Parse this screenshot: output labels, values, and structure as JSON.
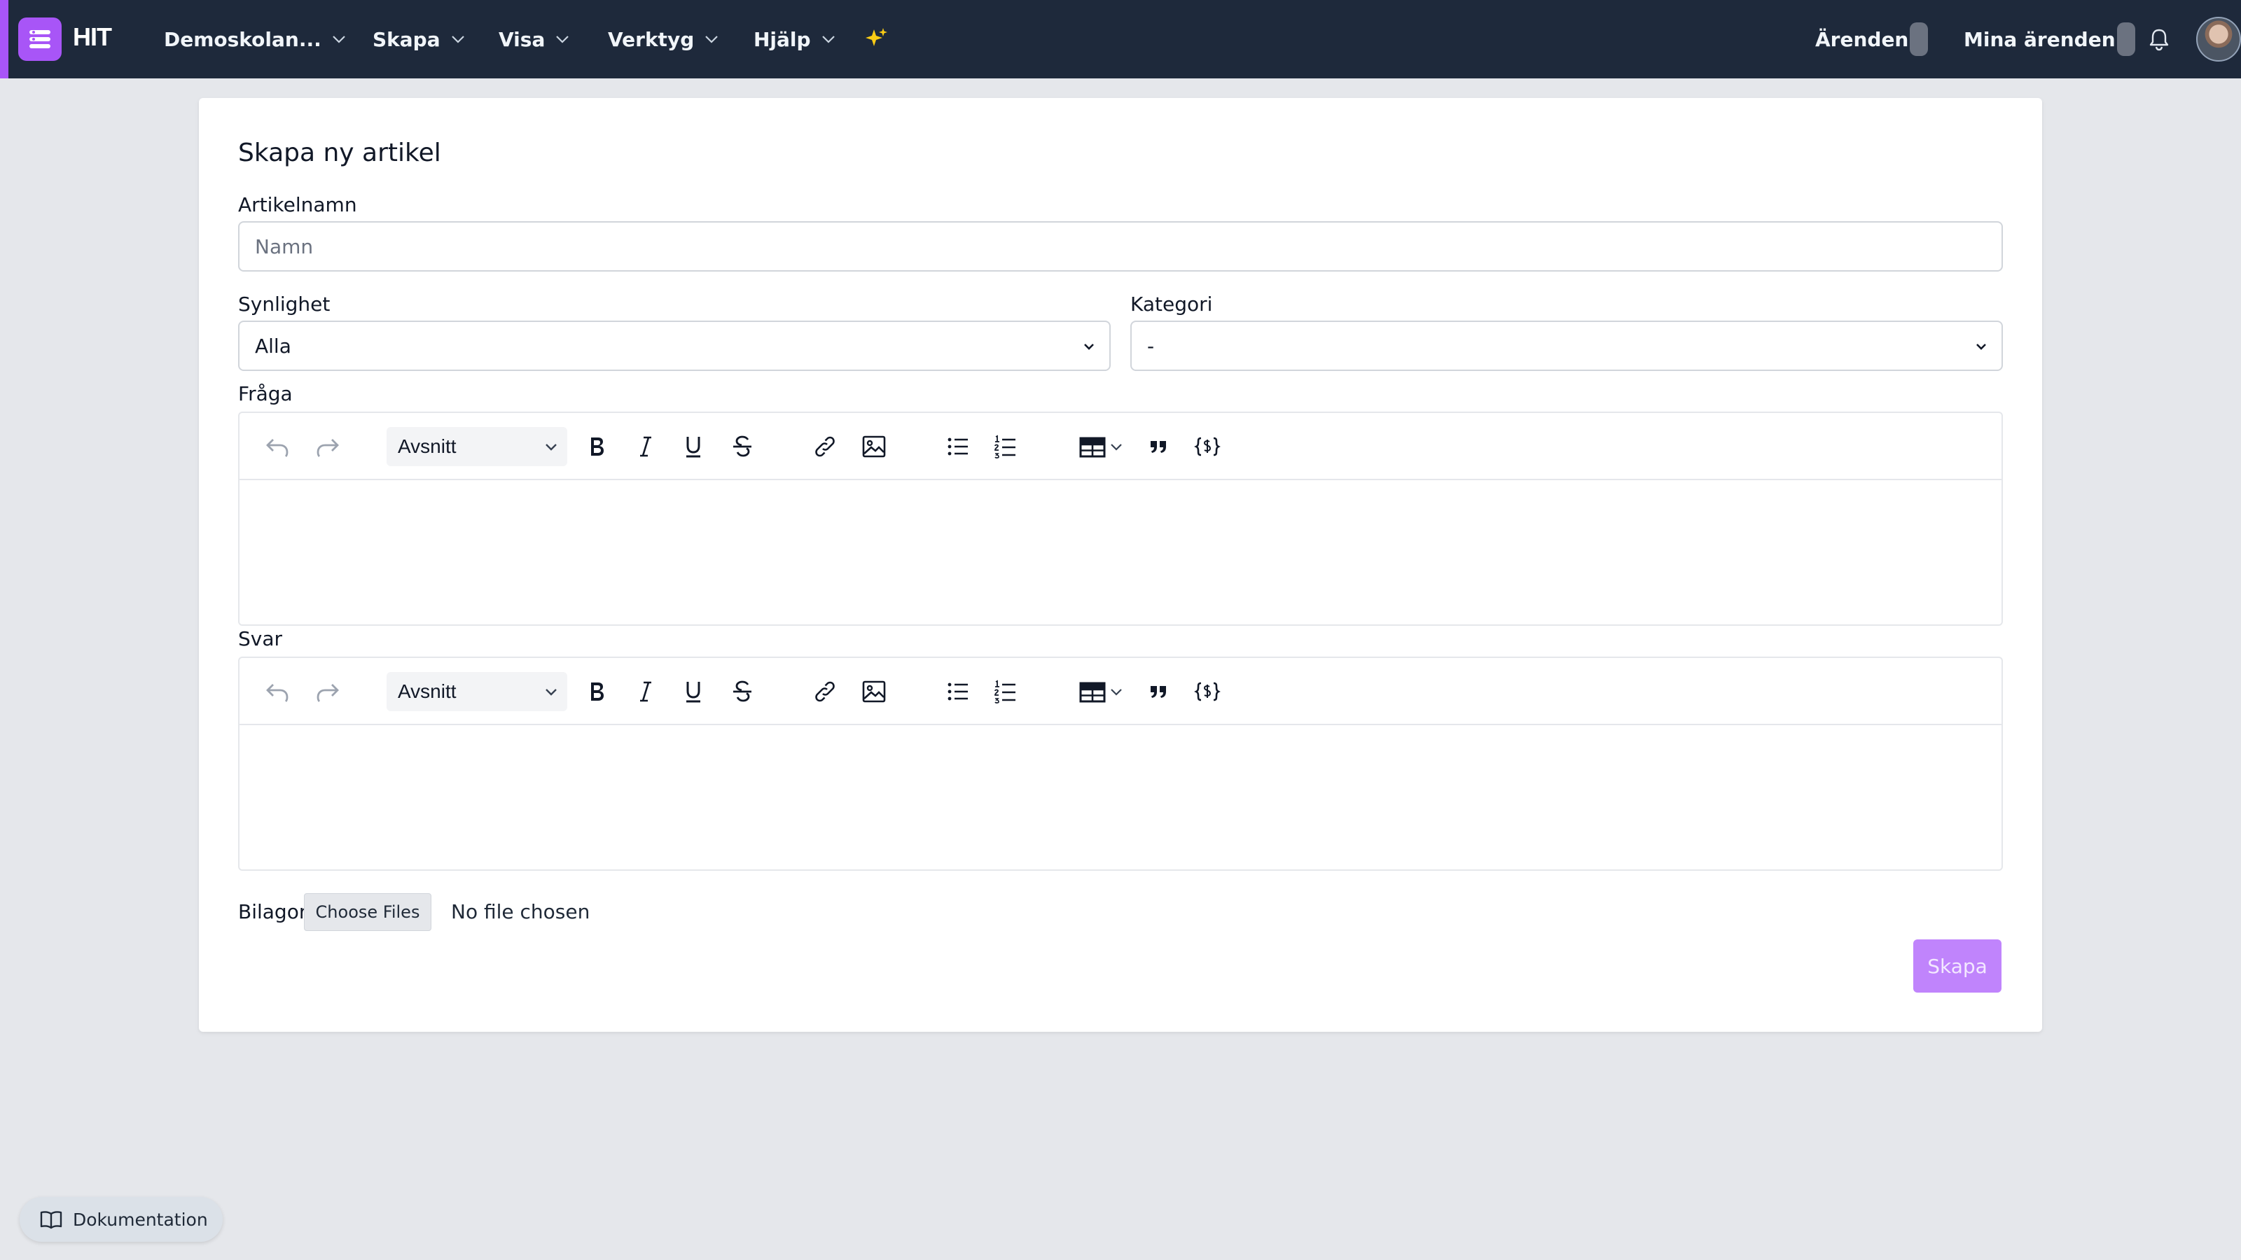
{
  "navbar": {
    "brand": "HIT",
    "menus": [
      {
        "label": "Demoskolan..."
      },
      {
        "label": "Skapa"
      },
      {
        "label": "Visa"
      },
      {
        "label": "Verktyg"
      },
      {
        "label": "Hjälp"
      }
    ],
    "right": {
      "cases_label": "Ärenden",
      "my_cases_label": "Mina ärenden"
    },
    "icons": {
      "logo": "hit-logo-icon",
      "sparkle": "sparkle-icon",
      "bell": "bell-icon"
    }
  },
  "form": {
    "title": "Skapa ny artikel",
    "name_label": "Artikelnamn",
    "name_placeholder": "Namn",
    "name_value": "",
    "visibility_label": "Synlighet",
    "visibility_value": "Alla",
    "category_label": "Kategori",
    "category_value": "-",
    "question_label": "Fråga",
    "answer_label": "Svar",
    "editor_block_format": "Avsnitt",
    "attachments_label": "Bilagor",
    "choose_files_label": "Choose Files",
    "no_file_text": "No file chosen",
    "submit_label": "Skapa"
  },
  "colors": {
    "navbar_bg": "#1e293b",
    "accent": "#a855f7",
    "submit_bg": "#c084fc",
    "page_bg": "#e5e7eb",
    "sparkle": "#facc15"
  },
  "docs": {
    "label": "Dokumentation"
  }
}
